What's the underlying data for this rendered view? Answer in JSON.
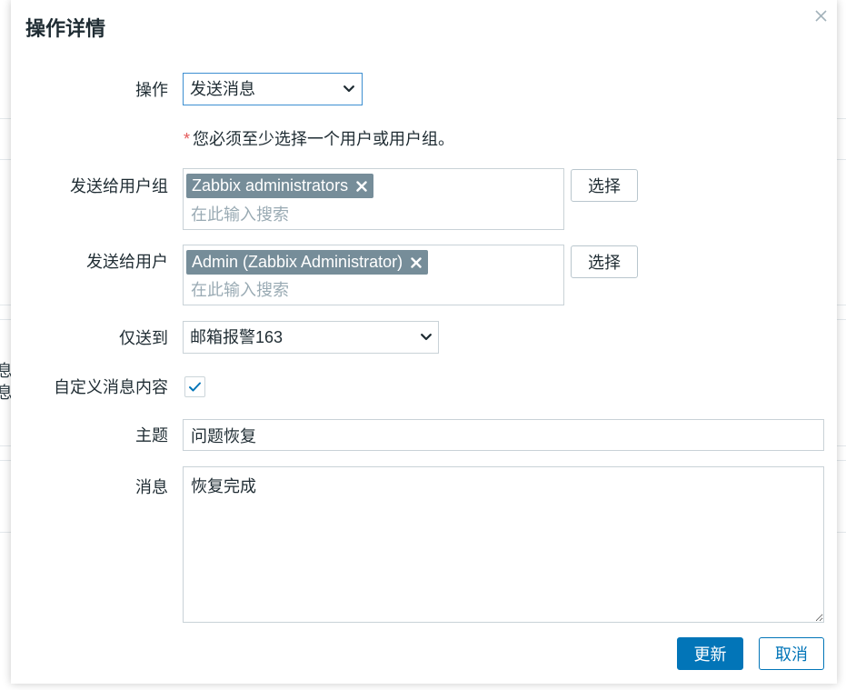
{
  "dialog": {
    "title": "操作详情",
    "close_icon": "close-icon"
  },
  "form": {
    "operation": {
      "label": "操作",
      "value": "发送消息",
      "icon": "chevron-down-icon"
    },
    "required_note": {
      "asterisk": "*",
      "text": "您必须至少选择一个用户或用户组。"
    },
    "user_groups": {
      "label": "发送给用户组",
      "tags": [
        {
          "label": "Zabbix administrators",
          "remove_icon": "x-icon"
        }
      ],
      "placeholder": "在此输入搜索",
      "select_button": "选择"
    },
    "users": {
      "label": "发送给用户",
      "tags": [
        {
          "label": "Admin (Zabbix Administrator)",
          "remove_icon": "x-icon"
        }
      ],
      "placeholder": "在此输入搜索",
      "select_button": "选择"
    },
    "send_only_to": {
      "label": "仅送到",
      "value": "邮箱报警163",
      "icon": "chevron-down-icon"
    },
    "custom_message": {
      "label": "自定义消息内容",
      "checked": true,
      "icon": "checkmark-icon"
    },
    "subject": {
      "label": "主题",
      "value": "问题恢复"
    },
    "message": {
      "label": "消息",
      "value": "恢复完成"
    }
  },
  "footer": {
    "update_button": "更新",
    "cancel_button": "取消"
  },
  "background": {
    "fragments": [
      "息",
      "息"
    ]
  },
  "colors": {
    "primary": "#0275b8",
    "tag_background": "#768d99",
    "required": "#e45959",
    "focus_border": "#3d8fd1",
    "text": "#1f2c33",
    "placeholder": "#9aabb4"
  }
}
